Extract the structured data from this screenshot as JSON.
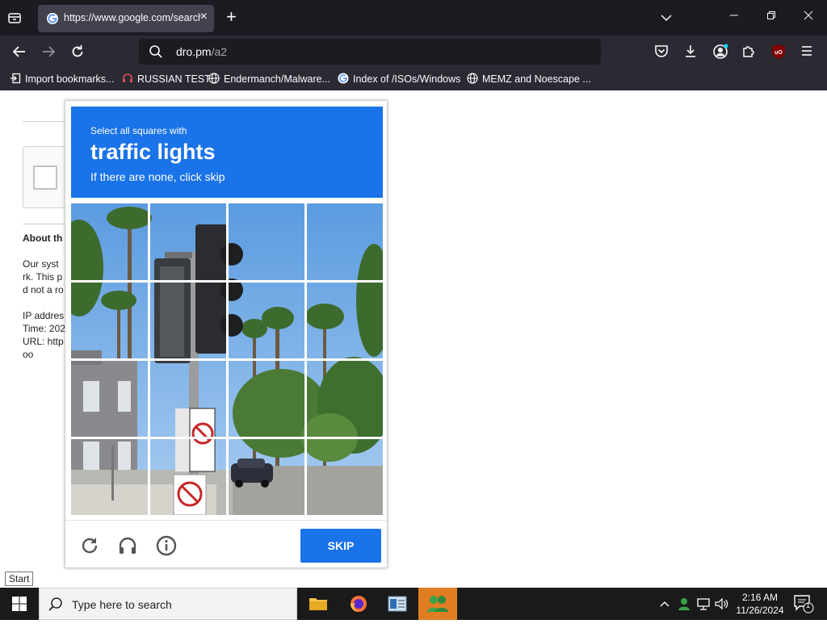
{
  "browser": {
    "tab": {
      "title": "https://www.google.com/search"
    },
    "url": {
      "host": "dro.pm",
      "path": "/a2"
    },
    "bookmarks": [
      {
        "label": "Import bookmarks...",
        "icon": "import-icon"
      },
      {
        "label": "RUSSIAN TEST",
        "icon": "headset-icon"
      },
      {
        "label": "Endermanch/Malware...",
        "icon": "globe-icon"
      },
      {
        "label": "Index of /ISOs/Windows",
        "icon": "google-icon"
      },
      {
        "label": "MEMZ and Noescape ...",
        "icon": "globe-icon"
      }
    ]
  },
  "page": {
    "about_heading": "About th",
    "lines": [
      "Our syst",
      "rk. This p",
      "d not a ro",
      "IP addres",
      "Time: 202",
      "URL: http",
      "oo"
    ]
  },
  "captcha": {
    "instruction_small": "Select all squares with",
    "target": "traffic lights",
    "instruction_hint": "If there are none, click skip",
    "skip_label": "SKIP",
    "accent": "#1a73e8"
  },
  "tooltip": {
    "text": "Start"
  },
  "taskbar": {
    "search_placeholder": "Type here to search",
    "time": "2:16 AM",
    "date": "11/26/2024",
    "notification_count": "1",
    "active_app_color": "#e07d22"
  }
}
